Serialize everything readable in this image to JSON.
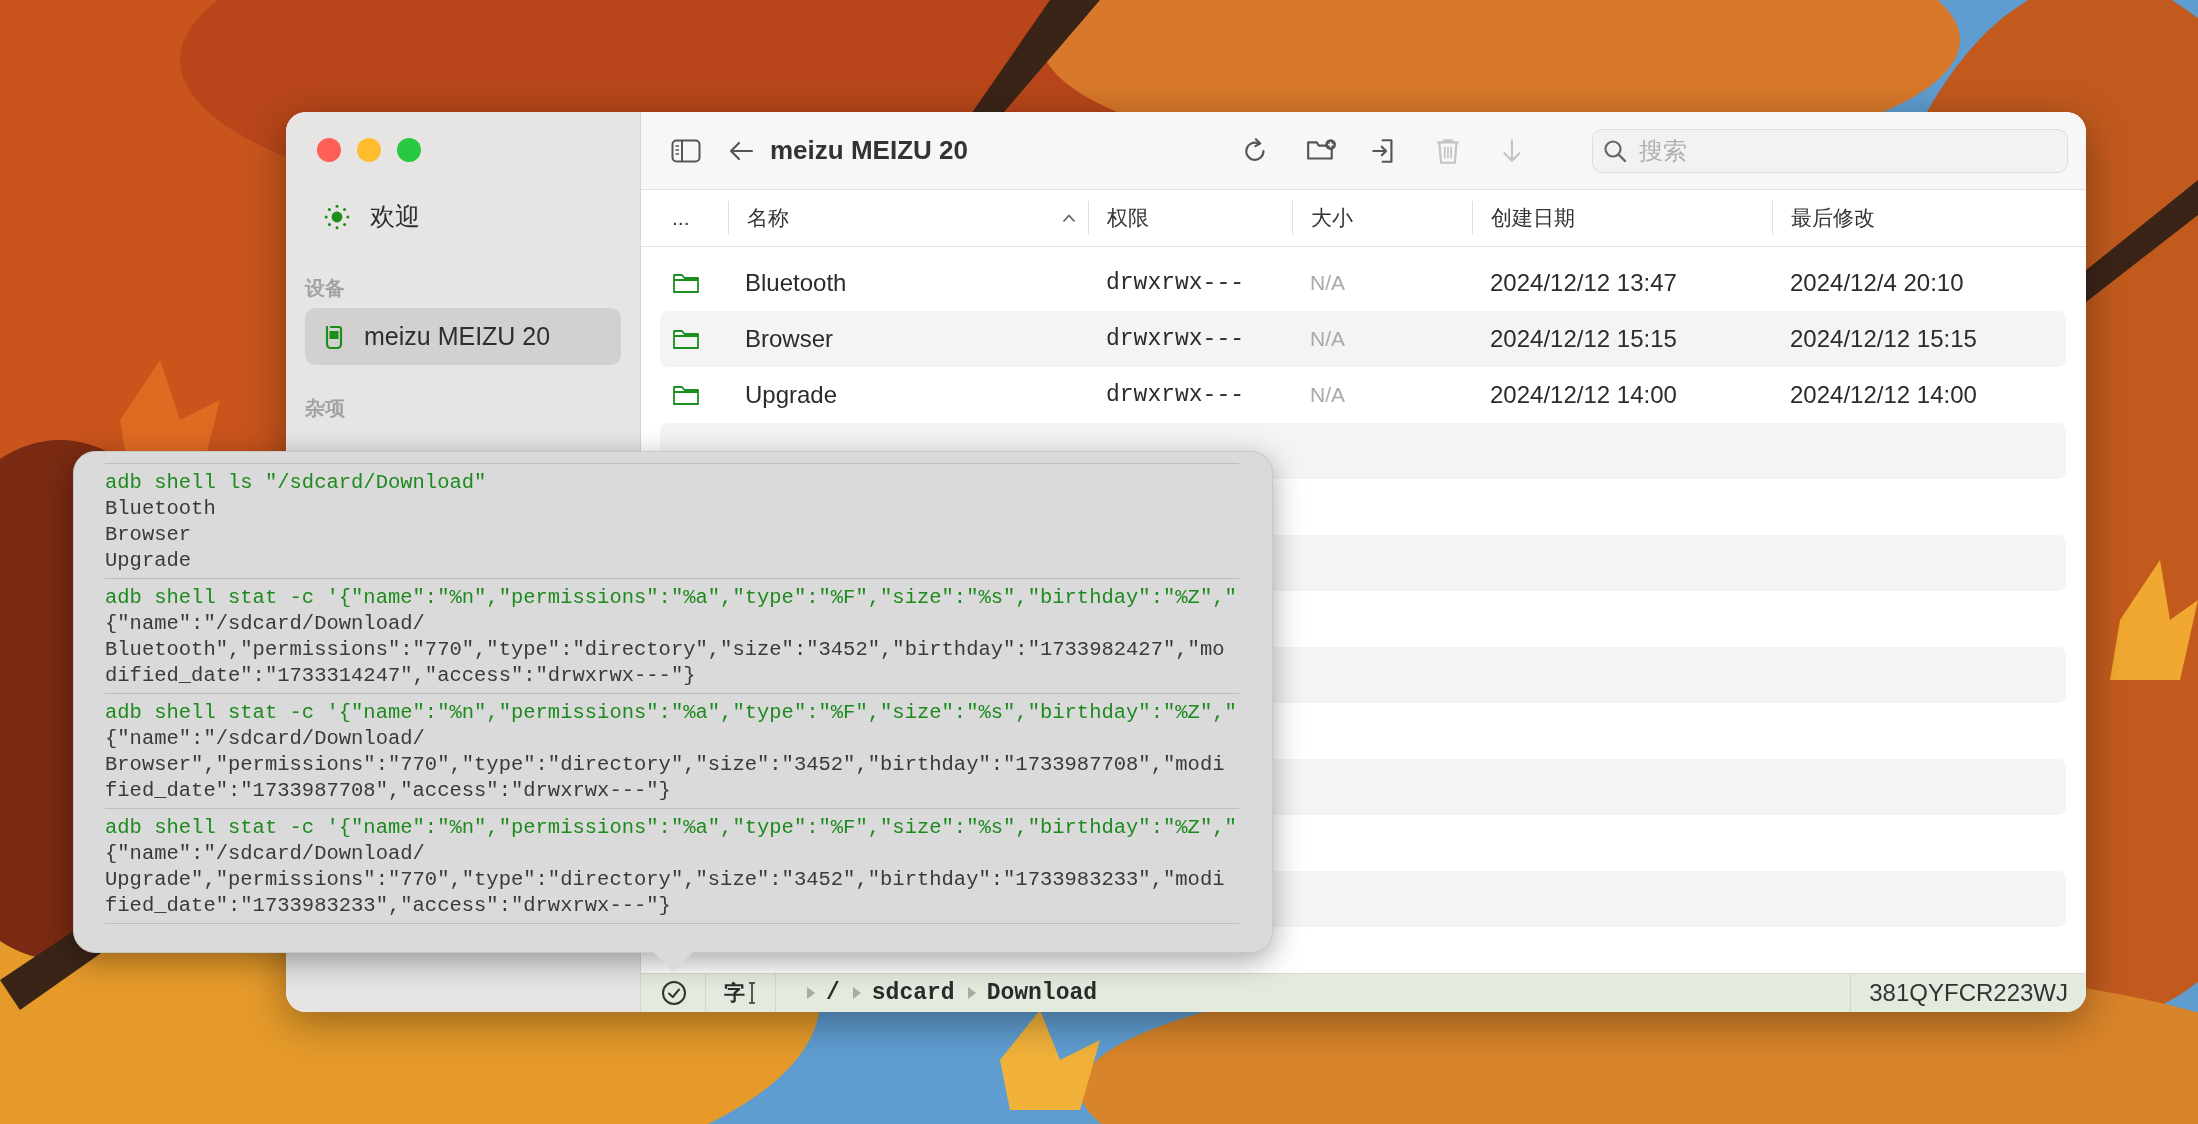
{
  "sidebar": {
    "items": [
      {
        "kind": "welcome",
        "label": "欢迎",
        "selected": false
      },
      {
        "kind": "heading",
        "label": "设备"
      },
      {
        "kind": "device",
        "label": "meizu MEIZU 20",
        "selected": true
      },
      {
        "kind": "heading",
        "label": "杂项"
      }
    ]
  },
  "toolbar": {
    "title": "meizu MEIZU 20",
    "actions": [
      {
        "kind": "refresh",
        "disabled": false
      },
      {
        "kind": "new-folder",
        "disabled": false
      },
      {
        "kind": "import",
        "disabled": false
      },
      {
        "kind": "delete",
        "disabled": true
      },
      {
        "kind": "download",
        "disabled": true
      }
    ],
    "search": {
      "placeholder": "搜索"
    }
  },
  "table": {
    "columns": [
      {
        "label": "...",
        "sorted": false
      },
      {
        "label": "名称",
        "sorted": true
      },
      {
        "label": "权限",
        "sorted": false
      },
      {
        "label": "大小",
        "sorted": false
      },
      {
        "label": "创建日期",
        "sorted": false
      },
      {
        "label": "最后修改",
        "sorted": false
      }
    ],
    "rows": [
      {
        "name": "Bluetooth",
        "permissions": "drwxrwx---",
        "size": "N/A",
        "created": "2024/12/12 13:47",
        "modified": "2024/12/4 20:10",
        "selected": false
      },
      {
        "name": "Browser",
        "permissions": "drwxrwx---",
        "size": "N/A",
        "created": "2024/12/12 15:15",
        "modified": "2024/12/12 15:15",
        "selected": false
      },
      {
        "name": "Upgrade",
        "permissions": "drwxrwx---",
        "size": "N/A",
        "created": "2024/12/12 14:00",
        "modified": "2024/12/12 14:00",
        "selected": false
      }
    ]
  },
  "log_popover": {
    "entries": [
      {
        "command": "adb shell ls \"/sdcard/Download\"",
        "output": "Bluetooth\nBrowser\nUpgrade"
      },
      {
        "command": "adb shell stat -c '{\"name\":\"%n\",\"permissions\":\"%a\",\"type\":\"%F\",\"size\":\"%s\",\"birthday\":\"%Z\",\"",
        "output": "{\"name\":\"/sdcard/Download/\nBluetooth\",\"permissions\":\"770\",\"type\":\"directory\",\"size\":\"3452\",\"birthday\":\"1733982427\",\"mo\ndified_date\":\"1733314247\",\"access\":\"drwxrwx---\"}"
      },
      {
        "command": "adb shell stat -c '{\"name\":\"%n\",\"permissions\":\"%a\",\"type\":\"%F\",\"size\":\"%s\",\"birthday\":\"%Z\",\"",
        "output": "{\"name\":\"/sdcard/Download/\nBrowser\",\"permissions\":\"770\",\"type\":\"directory\",\"size\":\"3452\",\"birthday\":\"1733987708\",\"modi\nfied_date\":\"1733987708\",\"access\":\"drwxrwx---\"}"
      },
      {
        "command": "adb shell stat -c '{\"name\":\"%n\",\"permissions\":\"%a\",\"type\":\"%F\",\"size\":\"%s\",\"birthday\":\"%Z\",\"",
        "output": "{\"name\":\"/sdcard/Download/\nUpgrade\",\"permissions\":\"770\",\"type\":\"directory\",\"size\":\"3452\",\"birthday\":\"1733983233\",\"modi\nfied_date\":\"1733983233\",\"access\":\"drwxrwx---\"}"
      }
    ]
  },
  "status_bar": {
    "input_label": "字",
    "path": [
      "/",
      "sdcard",
      "Download"
    ],
    "serial": "381QYFCR223WJ"
  }
}
